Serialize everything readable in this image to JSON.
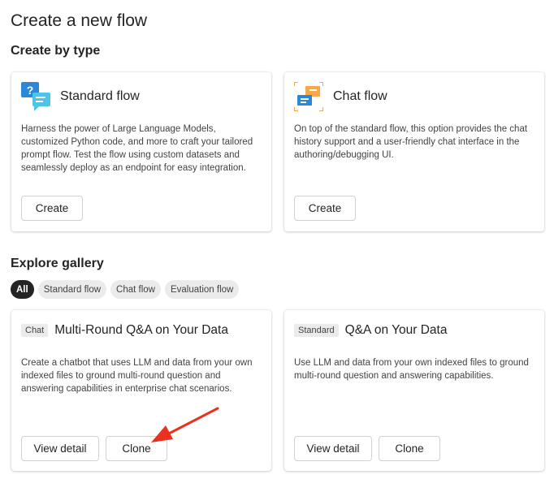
{
  "page": {
    "title": "Create a new flow"
  },
  "create_by_type": {
    "heading": "Create by type",
    "cards": [
      {
        "title": "Standard flow",
        "icon": "standard-flow-icon",
        "description": "Harness the power of Large Language Models, customized Python code, and more to craft your tailored prompt flow. Test the flow using custom datasets and seamlessly deploy as an endpoint for easy integration.",
        "button": "Create"
      },
      {
        "title": "Chat flow",
        "icon": "chat-flow-icon",
        "description": "On top of the standard flow, this option provides the chat history support and a user-friendly chat interface in the authoring/debugging UI.",
        "button": "Create"
      }
    ]
  },
  "gallery": {
    "heading": "Explore gallery",
    "filters": [
      "All",
      "Standard flow",
      "Chat flow",
      "Evaluation flow"
    ],
    "active_filter": "All",
    "cards": [
      {
        "badge": "Chat",
        "title": "Multi-Round Q&A on Your Data",
        "description": "Create a chatbot that uses LLM and data from your own indexed files to ground multi-round question and answering capabilities in enterprise chat scenarios.",
        "view_label": "View detail",
        "clone_label": "Clone"
      },
      {
        "badge": "Standard",
        "title": "Q&A on Your Data",
        "description": "Use LLM and data from your own indexed files to ground multi-round question and answering capabilities.",
        "view_label": "View detail",
        "clone_label": "Clone"
      }
    ]
  },
  "colors": {
    "accent_blue": "#2b88d8",
    "accent_orange": "#f7a94a",
    "annotation_arrow": "#e8321f",
    "active_pill": "#242424"
  }
}
